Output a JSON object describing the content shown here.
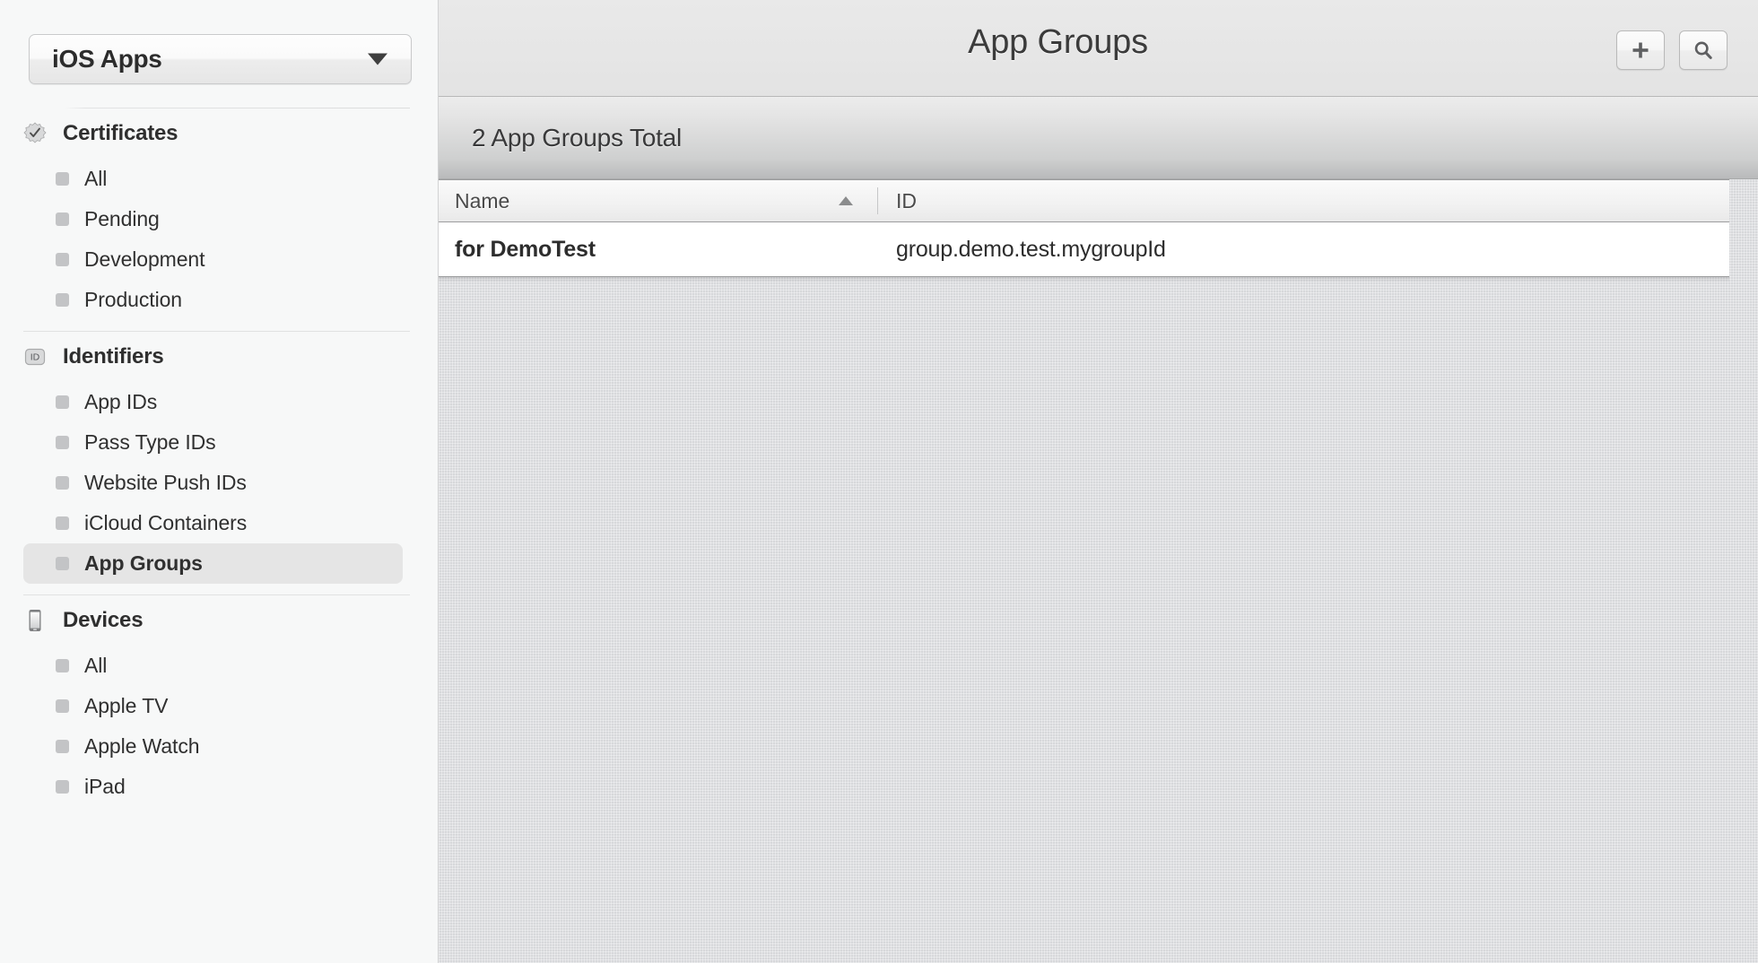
{
  "sidebar": {
    "org_select": {
      "value": "iOS Apps",
      "caret_icon": "chevron-down-icon"
    },
    "sections": [
      {
        "id": "certificates",
        "title": "Certificates",
        "icon": "certificate-badge-icon",
        "items": [
          {
            "label": "All",
            "selected": false
          },
          {
            "label": "Pending",
            "selected": false
          },
          {
            "label": "Development",
            "selected": false
          },
          {
            "label": "Production",
            "selected": false
          }
        ]
      },
      {
        "id": "identifiers",
        "title": "Identifiers",
        "icon": "id-badge-icon",
        "items": [
          {
            "label": "App IDs",
            "selected": false
          },
          {
            "label": "Pass Type IDs",
            "selected": false
          },
          {
            "label": "Website Push IDs",
            "selected": false
          },
          {
            "label": "iCloud Containers",
            "selected": false
          },
          {
            "label": "App Groups",
            "selected": true
          }
        ]
      },
      {
        "id": "devices",
        "title": "Devices",
        "icon": "device-phone-icon",
        "items": [
          {
            "label": "All",
            "selected": false
          },
          {
            "label": "Apple TV",
            "selected": false
          },
          {
            "label": "Apple Watch",
            "selected": false
          },
          {
            "label": "iPad",
            "selected": false
          }
        ]
      }
    ]
  },
  "header": {
    "title": "App Groups",
    "add_button": {
      "label": "+",
      "icon": "plus-icon"
    },
    "search_button": {
      "label": "",
      "icon": "search-icon"
    }
  },
  "count_bar": {
    "text": "2 App Groups Total"
  },
  "table": {
    "columns": [
      {
        "key": "name",
        "label": "Name",
        "sorted": "asc",
        "sort_icon": "sort-asc-arrow-icon"
      },
      {
        "key": "id",
        "label": "ID",
        "sorted": "none"
      }
    ],
    "rows": [
      {
        "name": "for DemoTest",
        "id": "group.demo.test.mygroupId"
      }
    ]
  },
  "colors": {
    "sidebar_bg": "#f7f8f8",
    "selected_item_bg": "#e5e5e5",
    "content_bg": "#dcdde0",
    "topbar_bg": "#e6e6e6",
    "row_bg": "#ffffff",
    "text": "#2d2d2d"
  }
}
